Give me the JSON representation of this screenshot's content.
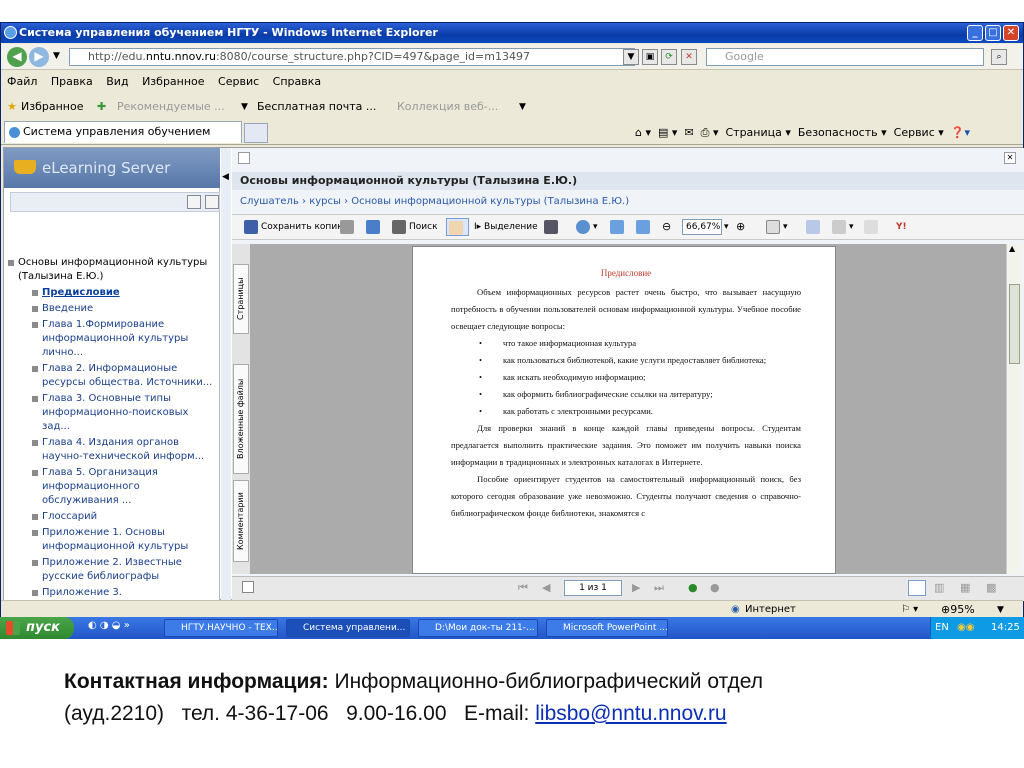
{
  "window": {
    "title": "Система управления обучением НГТУ - Windows Internet Explorer"
  },
  "address": {
    "url_prefix": "http://edu.",
    "url_host": "nntu.nnov.ru",
    "url_rest": ":8080/course_structure.php?CID=497&page_id=m13497",
    "search_placeholder": "Google"
  },
  "menu": [
    "Файл",
    "Правка",
    "Вид",
    "Избранное",
    "Сервис",
    "Справка"
  ],
  "favorites": {
    "label": "Избранное",
    "items": [
      "Рекомендуемые ...",
      "Бесплатная почта ...",
      "Коллекция веб-..."
    ]
  },
  "tabs": {
    "active": "Система управления обучением НГТУ"
  },
  "command_bar": {
    "page": "Страница",
    "security": "Безопасность",
    "tools": "Сервис"
  },
  "left_panel": {
    "brand": "eLearning Server",
    "tree_root": "Основы информационной культуры (Талызина Е.Ю.)",
    "tree_items": [
      "Предисловие",
      "Введение",
      "Глава 1.Формирование информационной культуры лично...",
      "Глава 2. Информационые ресурсы общества. Источники...",
      "Глава 3. Основные типы информационно-поисковых зад...",
      "Глава 4. Издания органов научно-технической информ...",
      "Глава 5. Организация информационного обслуживания ...",
      "Глоссарий",
      "Приложение 1. Основы информационной культуры",
      "Приложение 2. Известные русские библиографы",
      "Приложение 3."
    ]
  },
  "main": {
    "header": "Основы информационной культуры (Талызина Е.Ю.)",
    "breadcrumb": "Слушатель › курсы › Основы информационной культуры (Талызина Е.Ю.)",
    "toolbar": {
      "save": "Сохранить копию",
      "search": "Поиск",
      "select": "Выделение",
      "zoom": "66,67%"
    },
    "side_tabs": [
      "Страницы",
      "Вложенные файлы",
      "Комментарии"
    ],
    "pager": "1 из 1"
  },
  "document": {
    "title": "Предисловие",
    "p1": "Объем информационных ресурсов растет очень быстро, что вызывает насущную потребность в обучении пользователей основам информационной культуры. Учебное пособие освещает следующие вопросы:",
    "bullets": [
      "что такое информационная культура",
      "как пользоваться библиотекой, какие услуги предоставляет библиотека;",
      "как искать необходимую информацию;",
      "как оформить библиографические ссылки на литературу;",
      "как работать с электронными ресурсами."
    ],
    "p2": "Для проверки знаний в конце каждой главы приведены вопросы. Студентам предлагается выполнить практические задания. Это поможет им получить навыки поиска информации в традиционных и электронных каталогах в Интернете.",
    "p3": "Пособие ориентирует студентов на самостоятельный информационный поиск, без которого сегодня образование уже невозможно. Студенты получают сведения о справочно-библиографическом фонде библиотеки, знакомятся с"
  },
  "status": {
    "zone": "Интернет",
    "zoom": "95%"
  },
  "taskbar": {
    "start": "пуск",
    "tasks": [
      "НГТУ.НАУЧНО - ТЕХ...",
      "Система управлени...",
      "D:\\Мои док-ты 211-...",
      "Microsoft PowerPoint ..."
    ],
    "lang": "EN",
    "time": "14:25"
  },
  "contact": {
    "label": "Контактная информация:",
    "dept": "Информационно-библиографический отдел",
    "room": "(ауд.2210)",
    "phone": "тел. 4-36-17-06",
    "hours": "9.00-16.00",
    "email_label": "E-mail:",
    "email": "libsbo@nntu.nnov.ru"
  }
}
